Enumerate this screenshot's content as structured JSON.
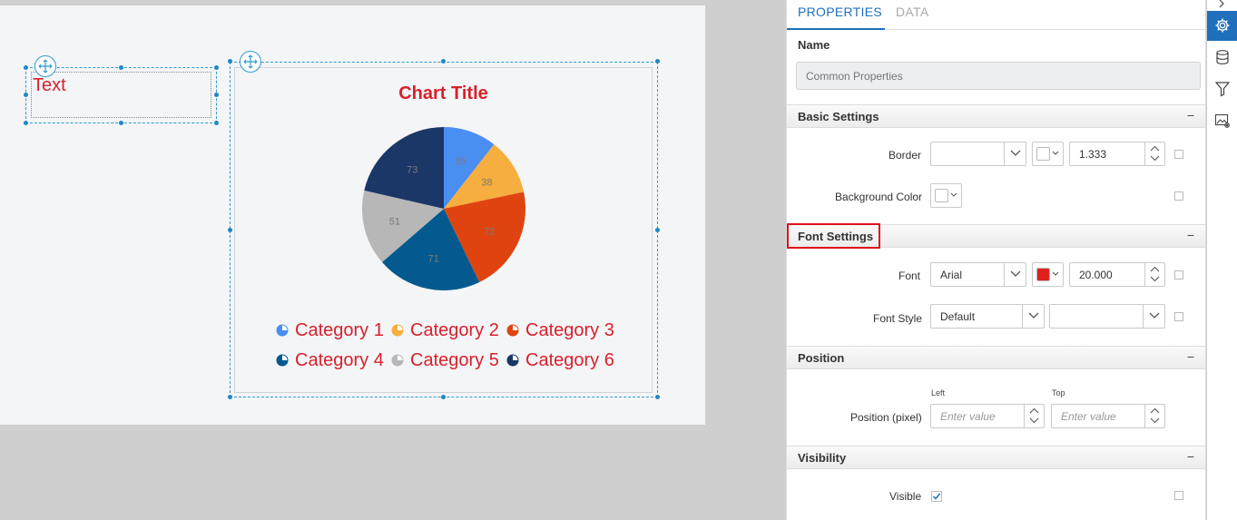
{
  "canvas": {
    "text_element": {
      "text": "Text"
    },
    "chart": {
      "title": "Chart Title",
      "legend": [
        "Category 1",
        "Category 2",
        "Category 3",
        "Category 4",
        "Category 5",
        "Category 6"
      ]
    }
  },
  "chart_data": {
    "type": "pie",
    "title": "Chart Title",
    "categories": [
      "Category 1",
      "Category 2",
      "Category 3",
      "Category 4",
      "Category 5",
      "Category 6"
    ],
    "values": [
      36,
      38,
      72,
      71,
      51,
      73
    ],
    "colors": [
      "#4a8ef2",
      "#f6ae3e",
      "#df4410",
      "#045a8f",
      "#b7b7b7",
      "#1b3768"
    ],
    "data_labels": [
      "36",
      "38",
      "72",
      "71",
      "51",
      "73"
    ],
    "legend_position": "bottom"
  },
  "panel": {
    "tabs": [
      {
        "label": "PROPERTIES",
        "active": true
      },
      {
        "label": "DATA",
        "active": false
      }
    ],
    "name": {
      "label": "Name",
      "placeholder": "Common Properties"
    },
    "sections": {
      "basic": {
        "title": "Basic Settings",
        "collapse": "−",
        "border_label": "Border",
        "border_style": "",
        "border_width": "1.333",
        "background_label": "Background Color"
      },
      "font": {
        "title": "Font Settings",
        "collapse": "−",
        "font_label": "Font",
        "font_family": "Arial",
        "font_color": "#e0201e",
        "font_size": "20.000",
        "style_label": "Font Style",
        "style_value": "Default",
        "style_extra": ""
      },
      "position": {
        "title": "Position",
        "collapse": "−",
        "left_label": "Left",
        "top_label": "Top",
        "row_label": "Position (pixel)",
        "left_placeholder": "Enter value",
        "top_placeholder": "Enter value"
      },
      "visibility": {
        "title": "Visibility",
        "collapse": "−",
        "visible_label": "Visible",
        "visible_checked": true
      }
    }
  },
  "rail": {
    "icons": [
      "chevron-right-icon",
      "gear-icon",
      "database-icon",
      "filter-icon",
      "image-settings-icon"
    ],
    "active": "gear-icon",
    "accent": "#1f6fbd"
  }
}
